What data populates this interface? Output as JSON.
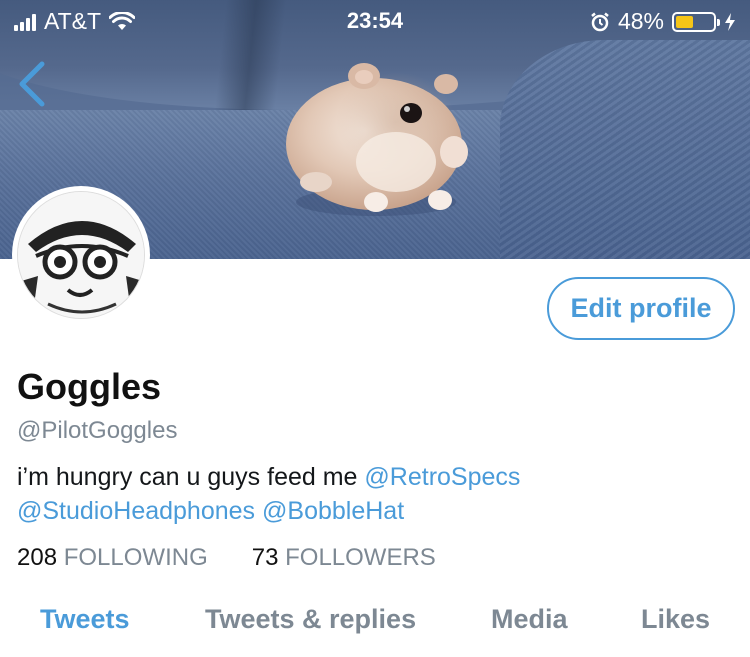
{
  "status_bar": {
    "carrier": "AT&T",
    "time": "23:54",
    "battery_percent": "48%",
    "battery_level": 0.48,
    "battery_color": "#f5c518"
  },
  "icons": {
    "back": "chevron-left-icon",
    "wifi": "wifi-icon",
    "alarm": "alarm-icon",
    "charging": "bolt-icon"
  },
  "profile": {
    "name": "Goggles",
    "handle": "@PilotGoggles",
    "bio_text": "i’m hungry can u guys feed me ",
    "mentions": [
      "@RetroSpecs",
      "@StudioHeadphones",
      "@BobbleHat"
    ],
    "edit_button_label": "Edit profile"
  },
  "stats": {
    "following_count": "208",
    "following_label": "FOLLOWING",
    "followers_count": "73",
    "followers_label": "FOLLOWERS"
  },
  "tabs": [
    {
      "label": "Tweets",
      "active": true
    },
    {
      "label": "Tweets & replies",
      "active": false
    },
    {
      "label": "Media",
      "active": false
    },
    {
      "label": "Likes",
      "active": false
    }
  ],
  "colors": {
    "accent": "#4a9bd9",
    "secondary_text": "#7d8893",
    "primary_text": "#14171a"
  }
}
